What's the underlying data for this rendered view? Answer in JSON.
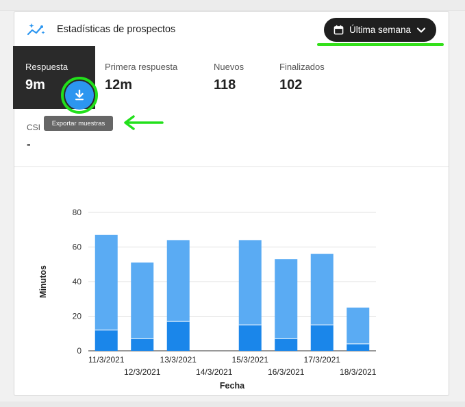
{
  "header": {
    "title": "Estadísticas de prospectos",
    "icon": "sparkle-chart-icon",
    "range_label": "Última semana"
  },
  "stats": [
    {
      "label": "Respuesta",
      "value": "9m",
      "active": true
    },
    {
      "label": "Primera respuesta",
      "value": "12m"
    },
    {
      "label": "Nuevos",
      "value": "118"
    },
    {
      "label": "Finalizados",
      "value": "102"
    }
  ],
  "csi": {
    "label": "CSI",
    "value": "-"
  },
  "tooltip": "Exportar muestras",
  "colors": {
    "accent": "#2c96f0",
    "bar_light": "#5aabf3",
    "bar_dark": "#1a86ea",
    "highlight": "#33e01a",
    "dark_button": "#1f1f1f"
  },
  "chart_data": {
    "type": "bar",
    "stacked": true,
    "categories": [
      "11/3/2021",
      "12/3/2021",
      "13/3/2021",
      "14/3/2021",
      "15/3/2021",
      "16/3/2021",
      "17/3/2021",
      "18/3/2021"
    ],
    "series": [
      {
        "values": [
          12,
          7,
          17,
          0,
          15,
          7,
          15,
          4
        ]
      },
      {
        "values": [
          55,
          44,
          47,
          0,
          49,
          46,
          41,
          21
        ]
      }
    ],
    "xlabel": "Fecha",
    "ylabel": "Minutos",
    "ylim": [
      0,
      80
    ],
    "yticks": [
      0,
      20,
      40,
      60,
      80
    ],
    "grid": true
  }
}
